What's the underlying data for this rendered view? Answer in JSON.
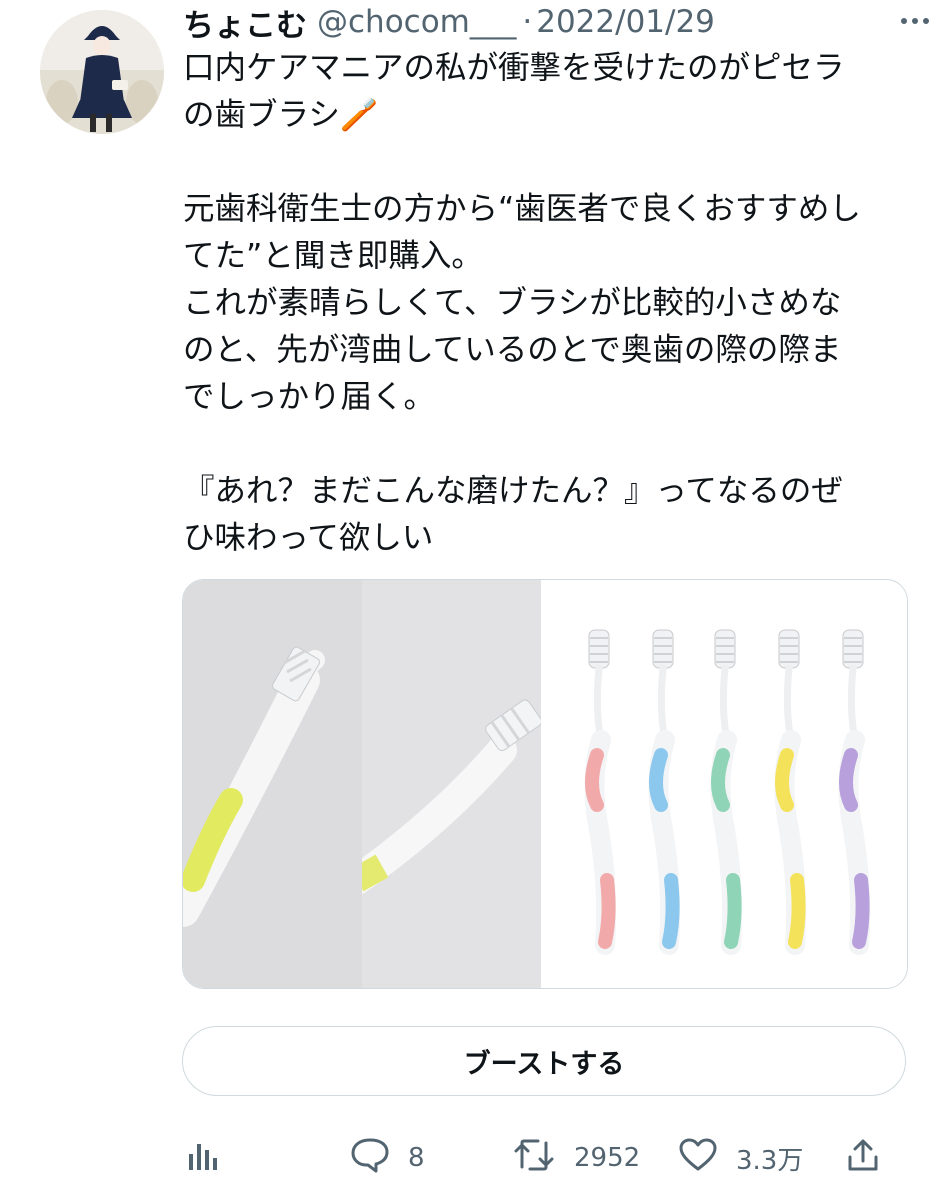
{
  "tweet": {
    "display_name": "ちょこむ",
    "handle": "@chocom___",
    "separator": "·",
    "date": "2022/01/29",
    "text_lines": [
      "口内ケアマニアの私が衝撃を受けたのがピセラ",
      "の歯ブラシ🪥",
      "",
      "元歯科衛生士の方から“歯医者で良くおすすめし",
      "てた”と聞き即購入。",
      "これが素晴らしくて、ブラシが比較的小さめな",
      "のと、先が湾曲しているのとで奥歯の際の際ま",
      "でしっかり届く。",
      "",
      "『あれ？まだこんな磨けたん？』ってなるのぜ",
      "ひ味わって欲しい"
    ]
  },
  "media": {
    "toothbrush_colors": [
      "#f2a9a9",
      "#8cc8ee",
      "#8fd4b6",
      "#f4e25a",
      "#b7a0dc"
    ]
  },
  "boost_button": {
    "label": "ブーストする"
  },
  "actions": {
    "analytics_icon": "bar-chart-icon",
    "reply_icon": "speech-bubble-icon",
    "reply_count": "8",
    "retweet_icon": "retweet-icon",
    "retweet_count": "2952",
    "like_icon": "heart-icon",
    "like_count": "3.3万",
    "share_icon": "share-upload-icon"
  },
  "colors": {
    "text_primary": "#0f1419",
    "text_secondary": "#536471",
    "border": "#cfd9de"
  }
}
